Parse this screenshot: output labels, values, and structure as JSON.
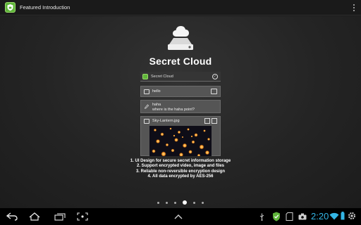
{
  "actionbar": {
    "title": "Featured Introduction"
  },
  "hero": {
    "title": "Secret Cloud"
  },
  "preview": {
    "app_title": "Secret Cloud",
    "rows": [
      {
        "line1": "hello"
      },
      {
        "line1": "haha",
        "line2": "where is the haha point?"
      },
      {
        "line1": "Sky-Lantern.jpg"
      }
    ]
  },
  "features": [
    "1. UI Design for secure secret information storage",
    "2. Support encrypted video, image and files",
    "3. Reliable non-reversible encryption design",
    "4. All data encrypted by AES-256"
  ],
  "pager": {
    "count": 6,
    "active_index": 3
  },
  "status_bar": {
    "time": "2:20",
    "accent": "#33b5e5"
  },
  "colors": {
    "brand": "#5fb53a"
  }
}
